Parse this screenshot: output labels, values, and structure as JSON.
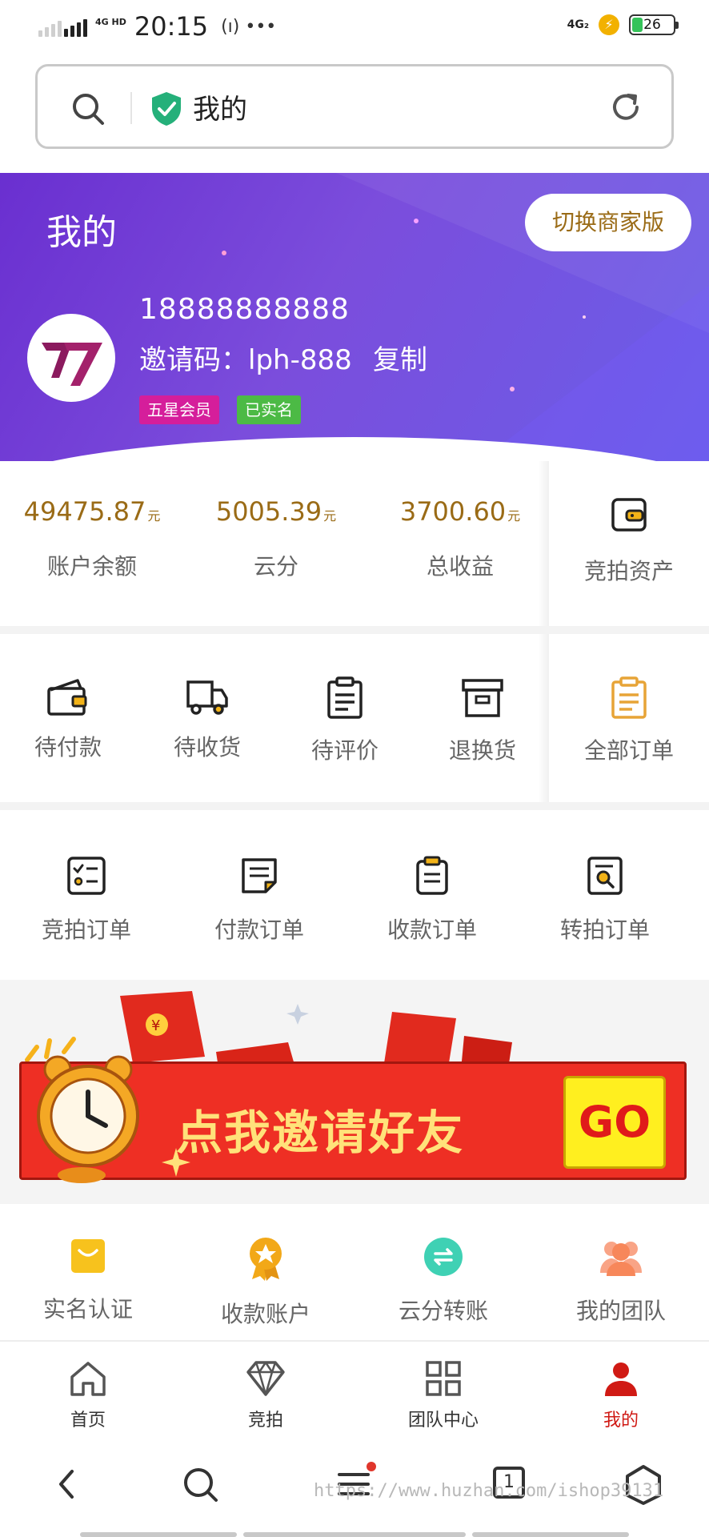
{
  "status_bar": {
    "network_label": "4G HD",
    "time": "20:15",
    "extra": "(ı) •••",
    "network_right": "4G₂",
    "battery": "26",
    "battery_level": 0.26
  },
  "url_bar": {
    "title": "我的"
  },
  "header": {
    "title": "我的",
    "switch_button": "切换商家版",
    "phone": "18888888888",
    "invite_label": "邀请码：lph-888",
    "copy_label": "复制",
    "badges": [
      "五星会员",
      "已实名"
    ]
  },
  "stats": [
    {
      "value": "49475.87",
      "unit": "元",
      "label": "账户余额"
    },
    {
      "value": "5005.39",
      "unit": "元",
      "label": "云分"
    },
    {
      "value": "3700.60",
      "unit": "元",
      "label": "总收益"
    }
  ],
  "stats_side": {
    "label": "竞拍资产",
    "icon": "wallet-card-icon"
  },
  "orders": [
    {
      "label": "待付款",
      "icon": "wallet-icon"
    },
    {
      "label": "待收货",
      "icon": "truck-icon"
    },
    {
      "label": "待评价",
      "icon": "clipboard-icon"
    },
    {
      "label": "退换货",
      "icon": "archive-box-icon"
    }
  ],
  "orders_side": {
    "label": "全部订单",
    "icon": "clipboard-list-icon"
  },
  "order_types": [
    {
      "label": "竞拍订单",
      "icon": "checklist-icon"
    },
    {
      "label": "付款订单",
      "icon": "note-icon"
    },
    {
      "label": "收款订单",
      "icon": "clipboard-icon"
    },
    {
      "label": "转拍订单",
      "icon": "document-search-icon"
    }
  ],
  "banner": {
    "text": "点我邀请好友",
    "go": "GO"
  },
  "services": [
    {
      "label": "实名认证",
      "icon": "id-card-icon",
      "color": "#f7c21d"
    },
    {
      "label": "收款账户",
      "icon": "medal-icon",
      "color": "#f2a818"
    },
    {
      "label": "云分转账",
      "icon": "transfer-icon",
      "color": "#3fd1b4"
    },
    {
      "label": "我的团队",
      "icon": "team-icon",
      "color": "#f7875a"
    }
  ],
  "tabs": [
    {
      "label": "首页",
      "icon": "home-icon"
    },
    {
      "label": "竞拍",
      "icon": "diamond-icon"
    },
    {
      "label": "团队中心",
      "icon": "grid-icon"
    },
    {
      "label": "我的",
      "icon": "user-icon"
    }
  ],
  "active_tab_color": "#d01a14",
  "nav": {
    "tab_count": "1",
    "watermark": "https://www.huzhan.com/ishop39131"
  },
  "colors": {
    "gold": "#9a6b16",
    "purple": "#7b4ddc"
  }
}
